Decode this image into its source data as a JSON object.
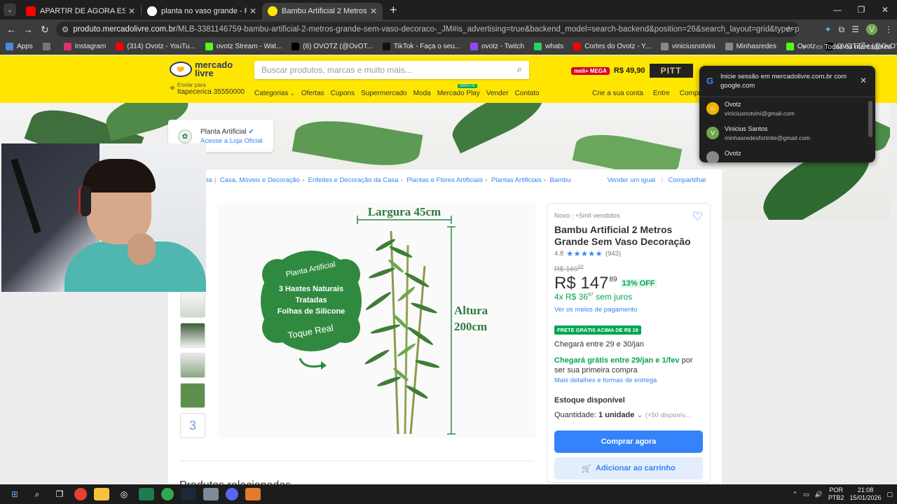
{
  "browser": {
    "tabs": [
      {
        "label": "APARTIR DE AGORA ESSE BAILE",
        "favicon_color": "#ff0000",
        "active": false
      },
      {
        "label": "planta no vaso grande - Pesqui",
        "favicon_color": "#ffffff",
        "active": false
      },
      {
        "label": "Bambu Artificial 2 Metros Gran",
        "favicon_color": "#ffe600",
        "active": true
      }
    ],
    "new_tab": "+",
    "url_host": "produto.mercadolivre.com.br",
    "url_path": "/MLB-3381146759-bambu-artificial-2-metros-grande-sem-vaso-decoraco-_JM#is_advertising=true&backend_model=search-backend&position=26&search_layout=grid&type=pad&tracking_id=36e650b9-0a81-4f...",
    "profile_initial": "V",
    "bookmarks": [
      {
        "label": "Apps",
        "color": "#4a89dc"
      },
      {
        "label": "",
        "color": "#777777"
      },
      {
        "label": "Instagram",
        "color": "#e1306c"
      },
      {
        "label": "(314) Ovotz - YouTu...",
        "color": "#ff0000"
      },
      {
        "label": "ovotz Stream - Wat...",
        "color": "#53fc18"
      },
      {
        "label": "(6) OVOTZ (@OvOT...",
        "color": "#000000"
      },
      {
        "label": "TikTok - Faça o seu...",
        "color": "#111111"
      },
      {
        "label": "ovotz - Twitch",
        "color": "#9146ff"
      },
      {
        "label": "whats",
        "color": "#25d366"
      },
      {
        "label": "Cortes do Ovotz - Y...",
        "color": "#ff0000"
      },
      {
        "label": "viniciusnotvini",
        "color": "#888888"
      },
      {
        "label": "Minhasredes",
        "color": "#888888"
      },
      {
        "label": "Ovotz",
        "color": "#53fc18"
      },
      {
        "label": "OVOTZ🌬 (@OvOTzF...",
        "color": "#000000"
      }
    ],
    "bookmarks_more": "»",
    "all_bookmarks": "Todos os marcadores"
  },
  "ml": {
    "logo_line1": "mercado",
    "logo_line2": "livre",
    "search_placeholder": "Buscar produtos, marcas e muito mais...",
    "promo_badge": "meli+ MEGA",
    "promo_price": "R$ 49,90",
    "promo_brand": "PITT",
    "deliver_label": "Enviar para",
    "deliver_city": "Itapecerica 35550000",
    "nav": [
      "Categorias",
      "Ofertas",
      "Cupons",
      "Supermercado",
      "Moda",
      "Mercado Play",
      "Vender",
      "Contato"
    ],
    "play_badge": "GRÁTIS",
    "account_links": [
      "Crie a sua conta",
      "Entre",
      "Compras"
    ]
  },
  "store": {
    "name": "Planta Artificial",
    "link": "Acesse a Loja Oficial"
  },
  "breadcrumb": {
    "items": [
      "sta",
      "Casa, Móveis e Decoração",
      "Enfeites e Decoração da Casa",
      "Plantas e Flores Artificiais",
      "Plantas Artificiais",
      "Bambu"
    ],
    "actions": [
      "Vender um igual",
      "Compartilhar"
    ]
  },
  "gallery": {
    "width_label": "Largura 45cm",
    "height_label_1": "Altura",
    "height_label_2": "200cm",
    "badge_title": "Planta Artificial",
    "badge_line1": "3 Hastes Naturais",
    "badge_line2": "Tratadas",
    "badge_line3": "Folhas de Silicone",
    "badge_footer": "Toque Real",
    "more_count": "3"
  },
  "product": {
    "condition": "Novo",
    "sold": "+5mil vendidos",
    "title": "Bambu Artificial 2 Metros Grande Sem Vaso Decoração",
    "rating": "4.8",
    "stars": "★★★★★",
    "reviews": "(943)",
    "old_price": "R$ 169",
    "old_cents": "99",
    "price": "R$ 147",
    "price_cents": "89",
    "discount": "13% OFF",
    "installments": "4x R$ 36",
    "installments_cents": "97",
    "installments_suffix": "sem juros",
    "pay_link": "Ver os meios de pagamento",
    "frete_badge": "FRETE GRÁTIS ACIMA DE R$ 19",
    "arrival": "Chegará entre 29 e 30/jan",
    "free_arrival_green": "Chegará grátis entre 29/jan e 1/fev",
    "free_arrival_rest": "por ser sua primeira compra",
    "more_delivery": "Mais detalhes e formas de entrega",
    "stock": "Estoque disponível",
    "qty_label": "Quantidade:",
    "qty_value": "1 unidade",
    "qty_available": "(+50 disponív...",
    "buy_button": "Comprar agora",
    "cart_button": "Adicionar ao carrinho",
    "related": "Produtos relacionados"
  },
  "google_popup": {
    "title": "Inicie sessão em mercadolivre.com.br com google.com",
    "accounts": [
      {
        "name": "Ovotz",
        "email": "viniciusnotvini@gmail.com",
        "avatar_color": "#f0b400",
        "initial": ""
      },
      {
        "name": "Vinicius Santos",
        "email": "minhasredesfortnite@gmail.com",
        "avatar_color": "#6fa84a",
        "initial": "V"
      },
      {
        "name": "Ovotz",
        "email": "",
        "avatar_color": "#888888",
        "initial": ""
      }
    ]
  },
  "taskbar": {
    "lang_1": "POR",
    "lang_2": "PTB2",
    "time": "21:08",
    "date": "15/01/2026"
  }
}
